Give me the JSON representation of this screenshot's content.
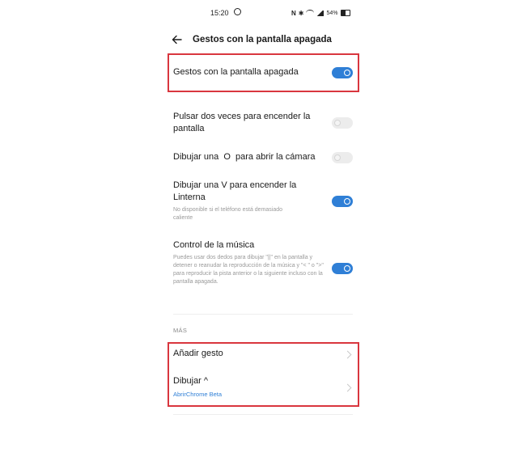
{
  "status_bar": {
    "time": "15:20",
    "battery_percent": "54%",
    "icons": [
      "whatsapp-icon",
      "nfc-icon",
      "bluetooth-icon",
      "wifi-icon",
      "signal-icon",
      "battery-icon"
    ]
  },
  "header": {
    "title": "Gestos con la pantalla apagada"
  },
  "master_toggle": {
    "label": "Gestos con la pantalla apagada",
    "enabled": true
  },
  "settings": [
    {
      "title": "Pulsar dos veces para encender la pantalla",
      "enabled": false
    },
    {
      "title": "Dibujar una  O  para abrir la cámara",
      "enabled": false
    },
    {
      "title": "Dibujar una  V  para encender la Linterna",
      "description": "No disponible si el teléfono está demasiado caliente",
      "enabled": true
    },
    {
      "title": "Control de la música",
      "description": "Puedes usar dos dedos para dibujar \"||\" en la pantalla y detener o reanudar la reproducción de la música y \"< \" o \">\" para reproducir la pista anterior o la siguiente incluso con la pantalla apagada.",
      "enabled": true
    }
  ],
  "more_section": {
    "label": "MÁS",
    "items": [
      {
        "title": "Añadir gesto"
      },
      {
        "title": "Dibujar ^",
        "link": "AbrirChrome Beta"
      }
    ]
  },
  "colors": {
    "accent": "#2f7fd6",
    "highlight": "#d9363e",
    "toggle_off": "#ececec"
  }
}
